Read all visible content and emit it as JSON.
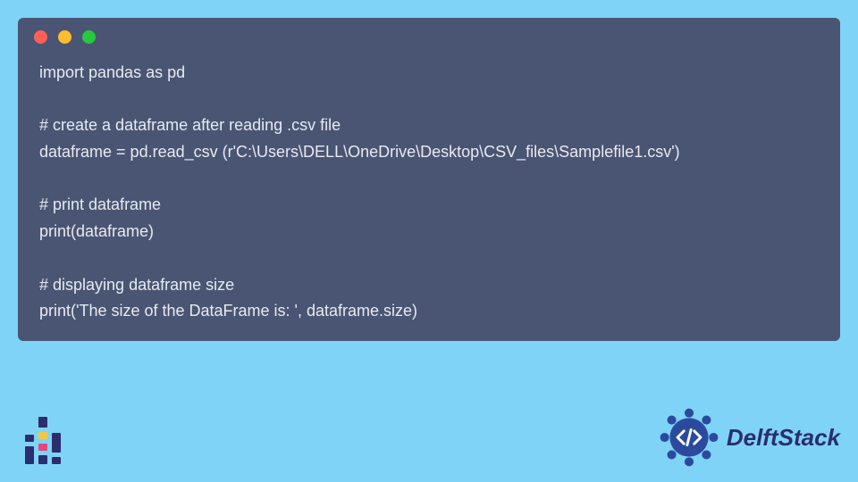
{
  "code": {
    "lines": [
      "import pandas as pd",
      "",
      "# create a dataframe after reading .csv file",
      "dataframe = pd.read_csv (r'C:\\Users\\DELL\\OneDrive\\Desktop\\CSV_files\\Samplefile1.csv')",
      "",
      "# print dataframe",
      "print(dataframe)",
      "",
      "# displaying dataframe size",
      "print('The size of the DataFrame is: ', dataframe.size)"
    ]
  },
  "brand": {
    "name": "DelftStack"
  }
}
